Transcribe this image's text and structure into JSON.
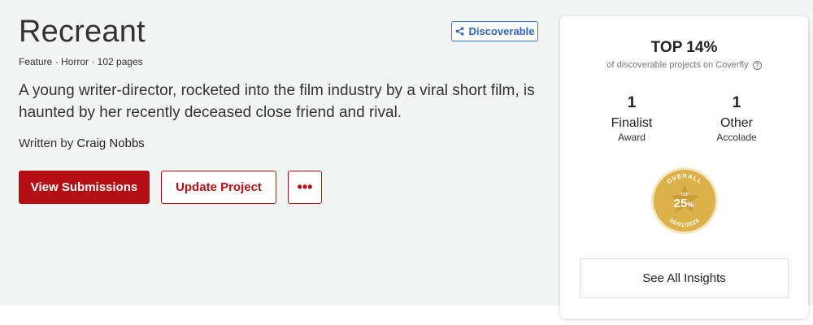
{
  "project": {
    "title": "Recreant",
    "meta": "Feature · Horror · 102 pages",
    "logline": "A young writer-director, rocketed into the film industry by a viral short film, is haunted by her recently deceased close friend and rival.",
    "written_by_prefix": "Written by",
    "author": "Craig Nobbs"
  },
  "badge": {
    "label": "Discoverable",
    "icon": "share-icon"
  },
  "actions": {
    "view_submissions": "View Submissions",
    "update_project": "Update Project",
    "more": "•••"
  },
  "insights": {
    "rank": "TOP 14%",
    "rank_sub": "of discoverable projects on Coverfly",
    "help": "?",
    "stats": [
      {
        "value": "1",
        "label": "Finalist",
        "kind": "Award"
      },
      {
        "value": "1",
        "label": "Other",
        "kind": "Accolade"
      }
    ],
    "overall_badge": {
      "top_text": "OVERALL",
      "small": "TOP",
      "value": "25",
      "unit": "%",
      "date": "05/01/2025"
    },
    "see_all": "See All Insights"
  },
  "colors": {
    "primary_red": "#b40e14",
    "badge_blue": "#2f63be",
    "gold": "#ddb14a",
    "hero_bg": "#f3f4f4"
  }
}
